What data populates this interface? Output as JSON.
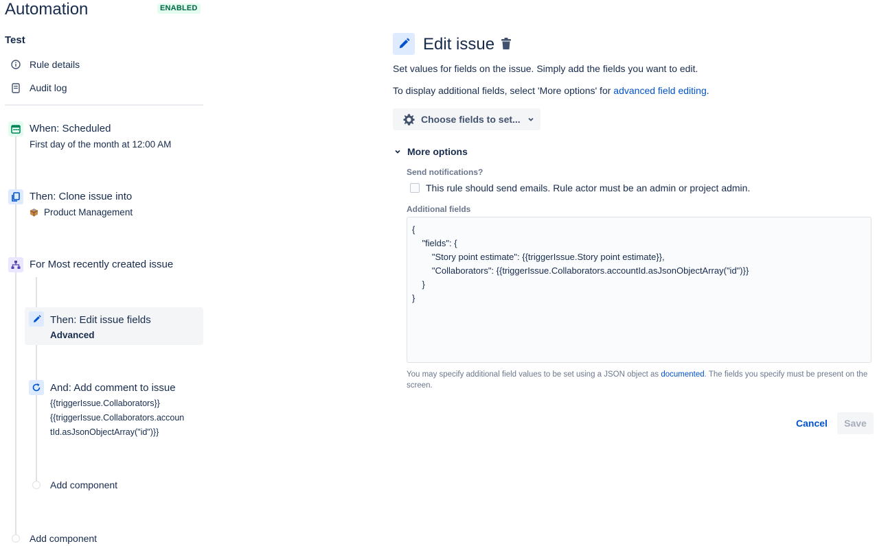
{
  "header": {
    "title": "Automation",
    "status": "ENABLED"
  },
  "sidebar": {
    "rule_name": "Test",
    "nav": [
      {
        "label": "Rule details",
        "icon": "info-icon"
      },
      {
        "label": "Audit log",
        "icon": "document-icon"
      }
    ],
    "components": [
      {
        "title": "When: Scheduled",
        "subtitle": "First day of the month at 12:00 AM",
        "icon": "calendar-icon"
      },
      {
        "title": "Then: Clone issue into",
        "subtitle": "Product Management",
        "icon": "copy-icon"
      },
      {
        "title": "For Most recently created issue",
        "icon": "branch-icon"
      },
      {
        "title": "Then: Edit issue fields",
        "subtitle": "Advanced",
        "icon": "pencil-icon"
      },
      {
        "title": "And: Add comment to issue",
        "subtitle_lines": [
          "{{triggerIssue.Collaborators}}",
          "{{triggerIssue.Collaborators.accoun",
          "tId.asJsonObjectArray(\"id\")}}"
        ],
        "icon": "refresh-icon"
      }
    ],
    "add_component_inner": "Add component",
    "add_component_outer": "Add component"
  },
  "panel": {
    "title": "Edit issue",
    "description": "Set values for fields on the issue. Simply add the fields you want to edit.",
    "more_info_prefix": "To display additional fields, select 'More options' for ",
    "more_info_link": "advanced field editing",
    "more_info_suffix": ".",
    "choose_fields": "Choose fields to set...",
    "more_options": "More options",
    "send_notifications_label": "Send notifications?",
    "send_notifications_text": "This rule should send emails. Rule actor must be an admin or project admin.",
    "additional_fields_label": "Additional fields",
    "json_lines": [
      "{",
      "    \"fields\": {",
      "        \"Story point estimate\": {{triggerIssue.Story point estimate}},",
      "        \"Collaborators\": {{triggerIssue.Collaborators.accountId.asJsonObjectArray(\"id\")}}",
      "    }",
      "}"
    ],
    "helper_prefix": "You may specify additional field values to be set using a JSON object as ",
    "helper_link": "documented",
    "helper_suffix": ". The fields you specify must be present on the screen.",
    "cancel": "Cancel",
    "save": "Save"
  },
  "colors": {
    "primary_text": "#172b4d",
    "link": "#0052cc",
    "enabled_bg": "#e3fcef",
    "enabled_text": "#006644"
  }
}
